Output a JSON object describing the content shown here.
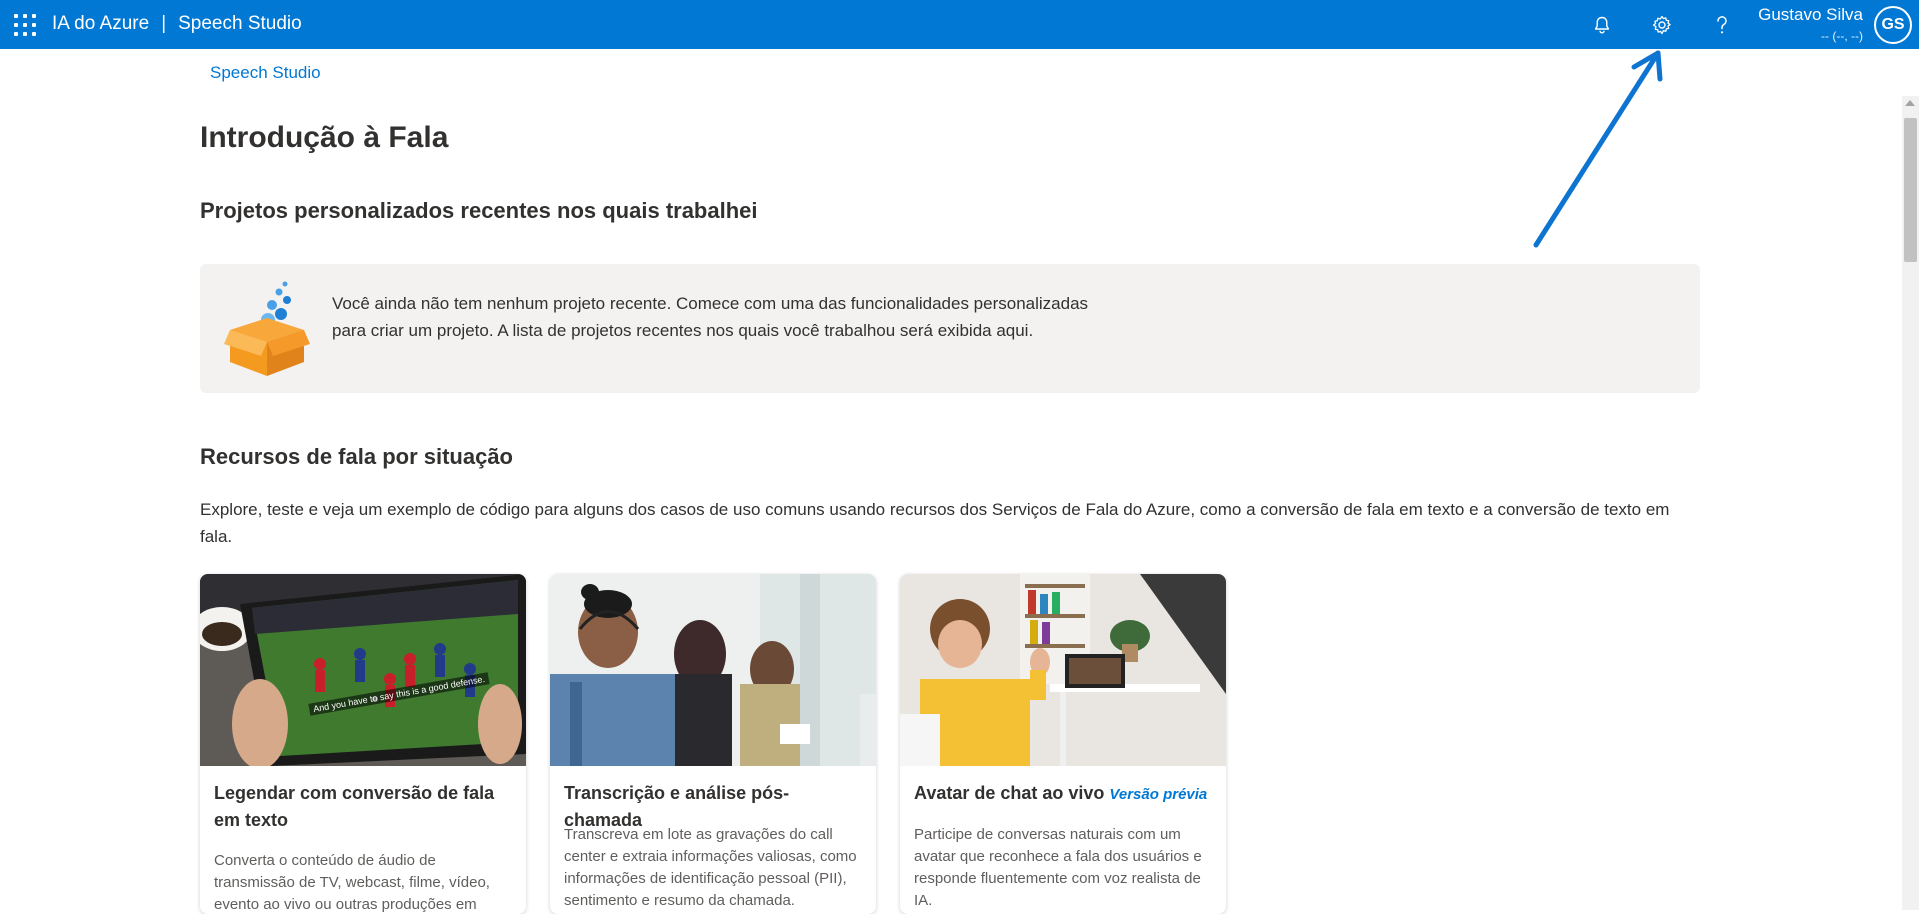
{
  "topbar": {
    "app_name": "IA do Azure",
    "separator": "|",
    "product": "Speech Studio",
    "icons": [
      "waffle-icon",
      "bell-icon",
      "gear-icon",
      "help-icon"
    ],
    "user_name": "Gustavo Silva",
    "user_sub": "-- (--, --)",
    "avatar_initials": "GS"
  },
  "breadcrumb": "Speech Studio",
  "page_title": "Introdução à Fala",
  "recent": {
    "heading": "Projetos personalizados recentes nos quais trabalhei",
    "empty_message": "Você ainda não tem nenhum projeto recente. Comece com uma das funcionalidades personalizadas para criar um projeto. A lista de projetos recentes nos quais você trabalhou será exibida aqui."
  },
  "scenarios": {
    "heading": "Recursos de fala por situação",
    "description": "Explore, teste e veja um exemplo de código para alguns dos casos de uso comuns usando recursos dos Serviços de Fala do Azure, como a conversão de fala em texto e a conversão de texto em fala.",
    "cards": [
      {
        "title": "Legendar com conversão de fala em texto",
        "badge": "",
        "image_caption": "And you have to say this is a good defense.",
        "body": "Converta o conteúdo de áudio de transmissão de TV, webcast, filme, vídeo, evento ao vivo ou outras produções em"
      },
      {
        "title": "Transcrição e análise pós-chamada",
        "badge": "",
        "body": "Transcreva em lote as gravações do call center e extraia informações valiosas, como informações de identificação pessoal (PII), sentimento e resumo da chamada."
      },
      {
        "title": "Avatar de chat ao vivo",
        "badge": "Versão prévia",
        "body": "Participe de conversas naturais com um avatar que reconhece a fala dos usuários e responde fluentemente com voz realista de IA."
      }
    ]
  },
  "colors": {
    "brand": "#0078d4",
    "panel": "#f3f2f1",
    "text": "#323130"
  }
}
